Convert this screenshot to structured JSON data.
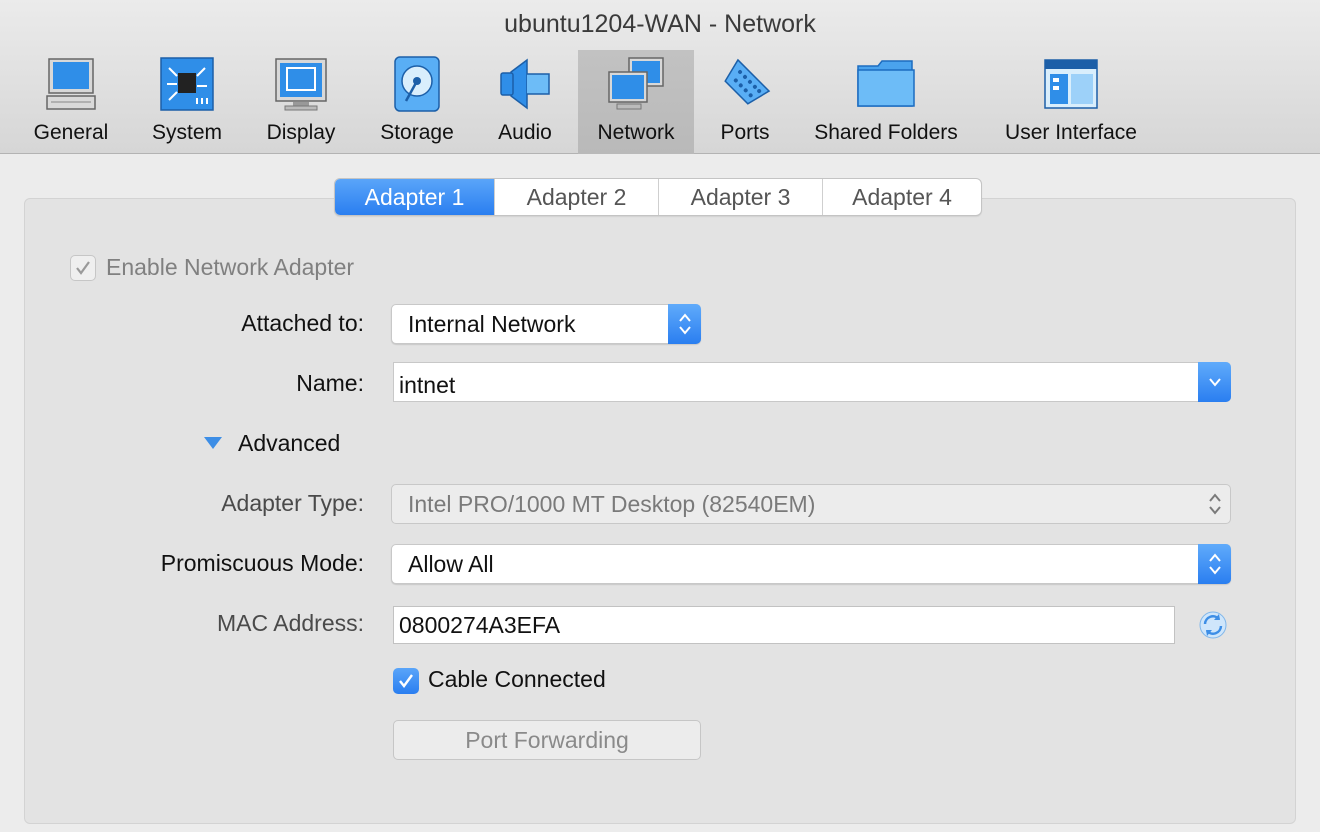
{
  "window": {
    "title": "ubuntu1204-WAN - Network"
  },
  "toolbar": {
    "items": [
      {
        "label": "General",
        "icon": "monitor-icon"
      },
      {
        "label": "System",
        "icon": "chip-icon"
      },
      {
        "label": "Display",
        "icon": "display-icon"
      },
      {
        "label": "Storage",
        "icon": "disk-icon"
      },
      {
        "label": "Audio",
        "icon": "speaker-icon"
      },
      {
        "label": "Network",
        "icon": "network-icon",
        "selected": true
      },
      {
        "label": "Ports",
        "icon": "serial-port-icon"
      },
      {
        "label": "Shared Folders",
        "icon": "folder-icon"
      },
      {
        "label": "User Interface",
        "icon": "window-layout-icon"
      }
    ]
  },
  "tabs": [
    {
      "label": "Adapter 1",
      "selected": true
    },
    {
      "label": "Adapter 2"
    },
    {
      "label": "Adapter 3"
    },
    {
      "label": "Adapter 4"
    }
  ],
  "form": {
    "enable_adapter": {
      "label": "Enable Network Adapter",
      "checked": true,
      "enabled": false
    },
    "attached_to": {
      "label": "Attached to:",
      "value": "Internal Network"
    },
    "name": {
      "label": "Name:",
      "value": "intnet"
    },
    "advanced": {
      "label": "Advanced",
      "expanded": true
    },
    "adapter_type": {
      "label": "Adapter Type:",
      "value": "Intel PRO/1000 MT Desktop (82540EM)",
      "enabled": false
    },
    "promiscuous_mode": {
      "label": "Promiscuous Mode:",
      "value": "Allow All"
    },
    "mac_address": {
      "label": "MAC Address:",
      "value": "0800274A3EFA"
    },
    "cable_connected": {
      "label": "Cable Connected",
      "checked": true
    },
    "port_forwarding": {
      "label": "Port Forwarding",
      "enabled": false
    }
  },
  "colors": {
    "accent": "#2a7ef0",
    "window_bg": "#ececec",
    "panel_bg": "#e3e3e3"
  }
}
